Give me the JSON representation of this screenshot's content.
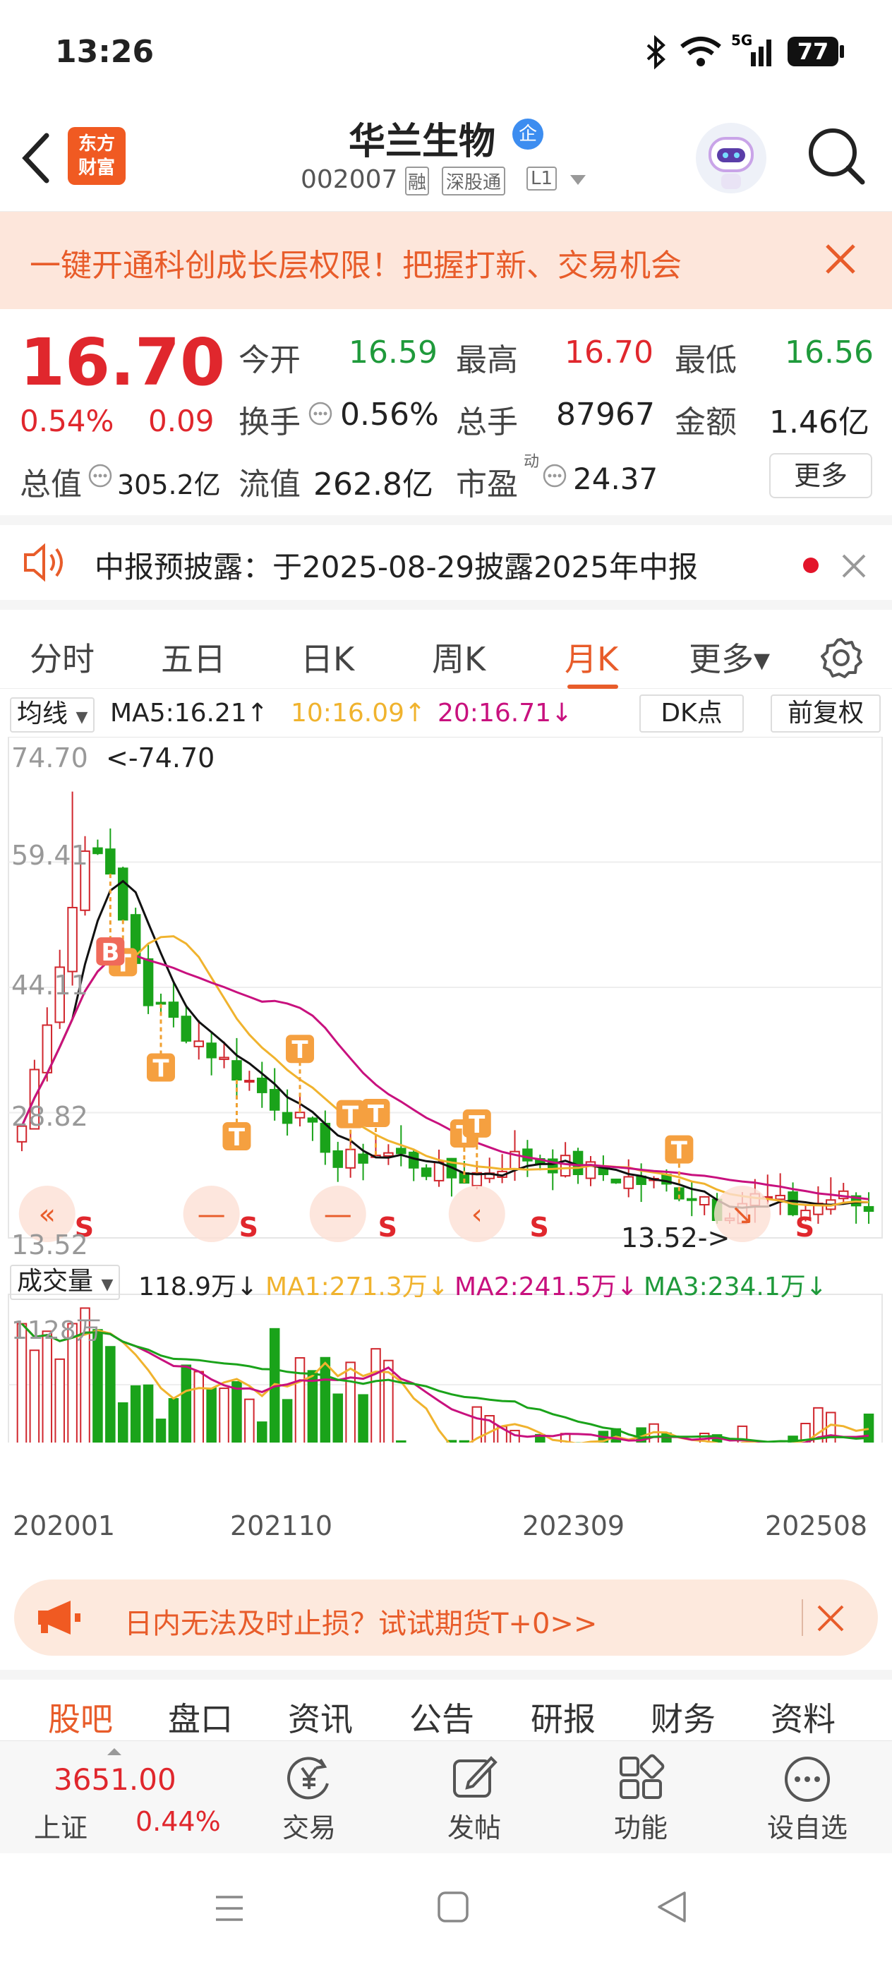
{
  "status_bar": {
    "time": "13:26",
    "battery": "77"
  },
  "header": {
    "title": "华兰生物",
    "badge": "企",
    "code": "002007",
    "tags": [
      "融",
      "深股通",
      "L1"
    ],
    "logo_line1": "东方",
    "logo_line2": "财富"
  },
  "promo": {
    "text": "一键开通科创成长层权限！把握打新、交易机会"
  },
  "quote": {
    "price": "16.70",
    "change_pct": "0.54%",
    "change_val": "0.09",
    "open_label": "今开",
    "open": "16.59",
    "high_label": "最高",
    "high": "16.70",
    "low_label": "最低",
    "low": "16.56",
    "turnover_label": "换手",
    "turnover": "0.56%",
    "volume_label": "总手",
    "volume": "87967",
    "amount_label": "金额",
    "amount": "1.46亿",
    "mktcap_label": "总值",
    "mktcap": "305.2亿",
    "float_label": "流值",
    "float": "262.8亿",
    "pe_label": "市盈",
    "pe_sup": "动",
    "pe": "24.37",
    "more": "更多"
  },
  "notice": {
    "text": "中报预披露：于2025-08-29披露2025年中报"
  },
  "tabs": [
    "分时",
    "五日",
    "日K",
    "周K",
    "月K",
    "更多▾"
  ],
  "active_tab": "月K",
  "ma_bar": {
    "select": "均线",
    "ma5": "MA5:16.21↑",
    "ma10": "10:16.09↑",
    "ma20": "20:16.71↓",
    "dk": "DK点",
    "fq": "前复权"
  },
  "price_axis": [
    "74.70",
    "59.41",
    "44.11",
    "28.82",
    "13.52"
  ],
  "annotations": {
    "high": "<-74.70",
    "low": "13.52->"
  },
  "vol_bar": {
    "select": "成交量",
    "vol": "118.9万↓",
    "ma1": "MA1:271.3万↓",
    "ma2": "MA2:241.5万↓",
    "ma3": "MA3:234.1万↓",
    "axis_top": "1128万"
  },
  "x_axis": [
    "202001",
    "202110",
    "202309",
    "202508"
  ],
  "marker_letters": {
    "t": "T",
    "b": "B",
    "s": "S"
  },
  "chart_data": {
    "type": "candlestick",
    "period": "monthly",
    "x_labels": [
      "202001",
      "202110",
      "202309",
      "202508"
    ],
    "y_range": [
      13.52,
      74.7
    ],
    "max_price": 74.7,
    "min_price": 13.52,
    "ma": {
      "MA5": 16.21,
      "MA10": 16.09,
      "MA20": 16.71
    },
    "volume": {
      "last_wan": 118.9,
      "MA1_wan": 271.3,
      "MA2_wan": 241.5,
      "MA3_wan": 234.1,
      "axis_max_wan": 1128
    },
    "colors": {
      "up": "#d0262d",
      "down": "#1aa31a",
      "ma5": "#111111",
      "ma10": "#f0b32e",
      "ma20": "#c8117e"
    }
  },
  "ad": {
    "text": "日内无法及时止损？试试期货T+0>>"
  },
  "bottom_tabs": [
    "股吧",
    "盘口",
    "资讯",
    "公告",
    "研报",
    "财务",
    "资料"
  ],
  "nav": {
    "index_value": "3651.00",
    "index_name": "上证",
    "index_change": "0.44%",
    "items": [
      "交易",
      "发帖",
      "功能",
      "设自选"
    ]
  }
}
